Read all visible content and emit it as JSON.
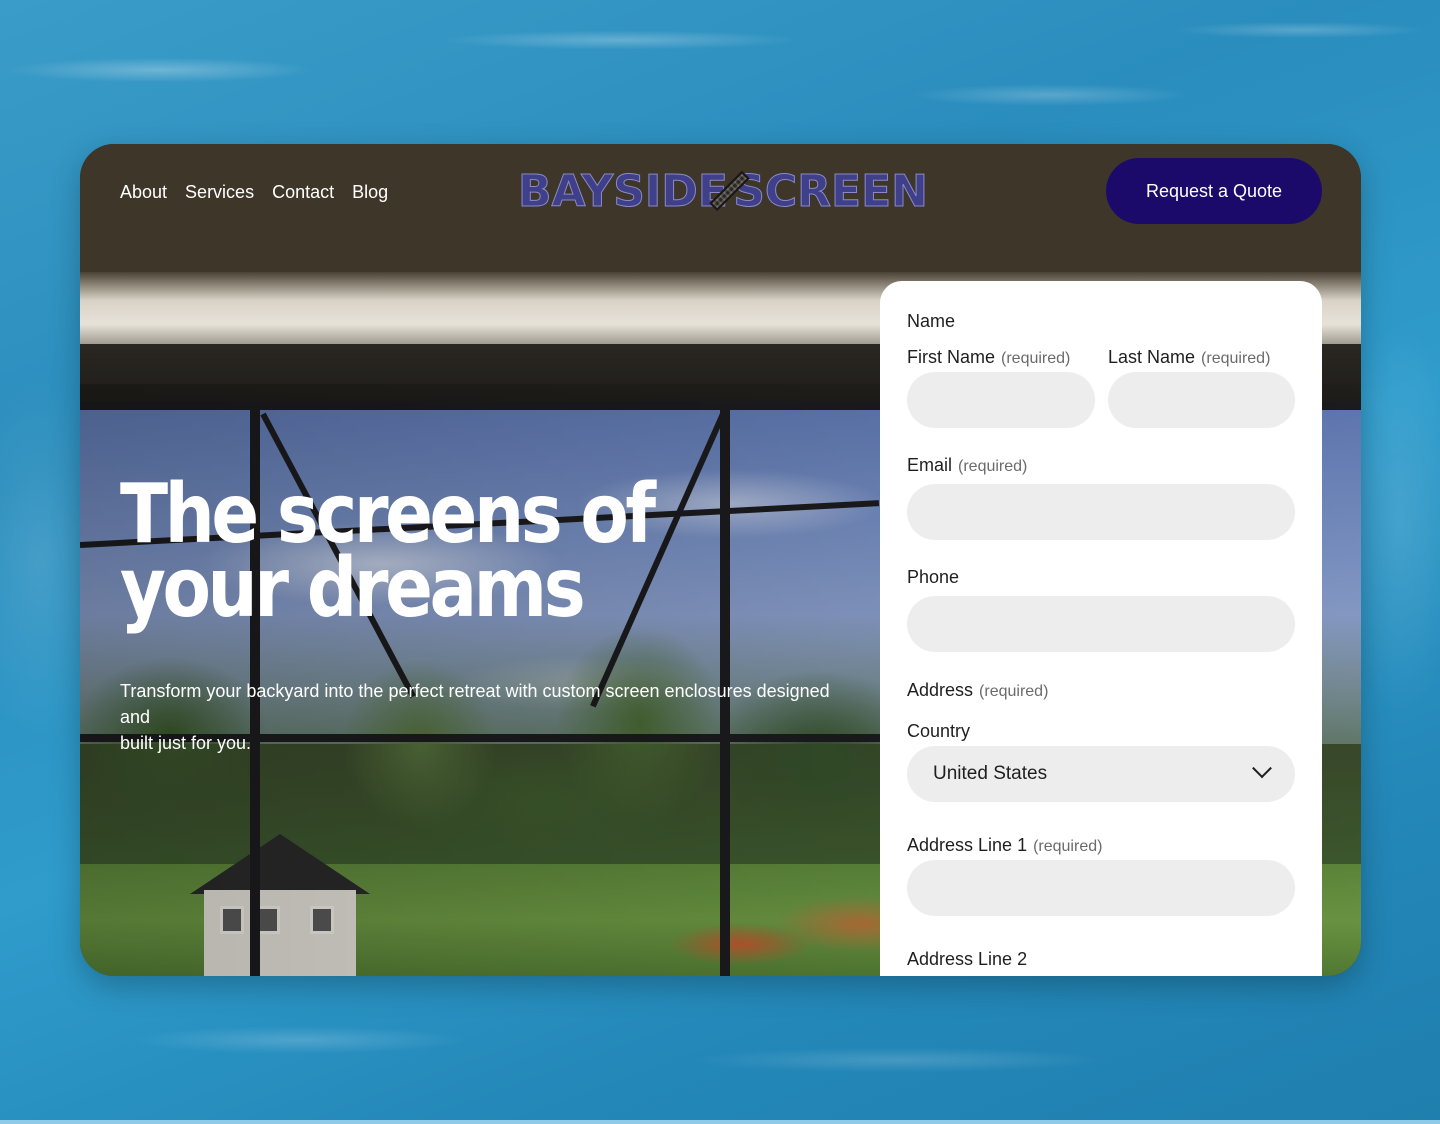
{
  "nav": {
    "items": [
      "About",
      "Services",
      "Contact",
      "Blog"
    ]
  },
  "logo": {
    "left": "BAYSIDE",
    "right": "SCREEN"
  },
  "header": {
    "cta_label": "Request a Quote"
  },
  "hero": {
    "title": "The screens of your dreams",
    "subtitle_line1": "Transform your backyard into the perfect retreat with custom screen enclosures designed and",
    "subtitle_line2": "built just for you."
  },
  "form": {
    "name_label": "Name",
    "first_name_label": "First Name",
    "last_name_label": "Last Name",
    "email_label": "Email",
    "phone_label": "Phone",
    "address_label": "Address",
    "country_label": "Country",
    "country_value": "United States",
    "address1_label": "Address Line 1",
    "address2_label": "Address Line 2",
    "required_text": "(required)"
  },
  "colors": {
    "cta_bg": "#1c0a6a",
    "logo_color": "#3f3f8a",
    "field_bg": "#ededee"
  }
}
